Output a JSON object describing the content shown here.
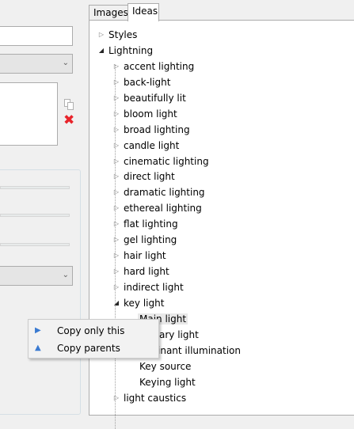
{
  "tabs": [
    {
      "label": "Images"
    },
    {
      "label": "Ideas"
    }
  ],
  "tree": {
    "styles": {
      "label": "Styles"
    },
    "lightning": {
      "label": "Lightning"
    },
    "items": [
      {
        "label": "accent lighting"
      },
      {
        "label": "back-light"
      },
      {
        "label": "beautifully lit"
      },
      {
        "label": "bloom light"
      },
      {
        "label": "broad lighting"
      },
      {
        "label": "candle light"
      },
      {
        "label": "cinematic lighting"
      },
      {
        "label": "direct light"
      },
      {
        "label": "dramatic lighting"
      },
      {
        "label": "ethereal lighting"
      },
      {
        "label": "flat lighting"
      },
      {
        "label": "gel lighting"
      },
      {
        "label": "hair light"
      },
      {
        "label": "hard light"
      },
      {
        "label": "indirect light"
      },
      {
        "label": "key light"
      }
    ],
    "key_light_children": [
      {
        "label": "Main light"
      },
      {
        "label": "ary light"
      },
      {
        "label": "inant illumination"
      },
      {
        "label": "Key source"
      },
      {
        "label": "Keying light"
      }
    ],
    "after": [
      {
        "label": "light caustics"
      }
    ]
  },
  "context_menu": {
    "copy_only_this": "Copy only this",
    "copy_parents": "Copy parents"
  },
  "colors": {
    "accent": "#3a7ad1",
    "delete": "#e8242b"
  }
}
